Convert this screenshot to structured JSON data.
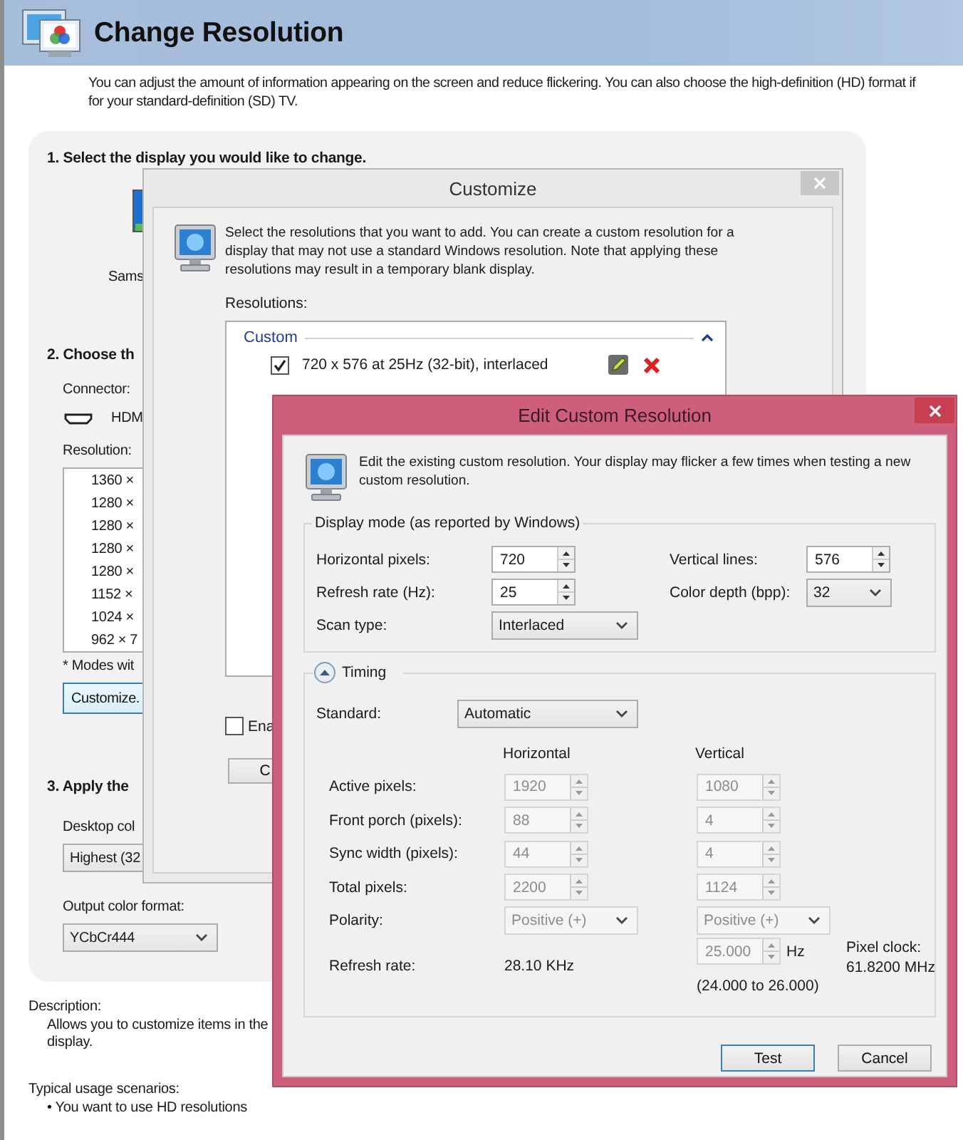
{
  "main_window": {
    "title": "Change Resolution",
    "intro_lines": [
      "You can adjust the amount of information appearing on the screen and reduce flickering. You can also choose the high-definition (HD) format if",
      "for your standard-definition (SD) TV."
    ],
    "step_1": {
      "heading": "1. Select the display you would like to change.",
      "display_name": "Sams"
    },
    "step_2": {
      "heading": "2. Choose th",
      "connector_label": "Connector:",
      "connector": "HDM",
      "resolution_label": "Resolution:",
      "resolutions": [
        {
          "label": "1360 ×",
          "selected": false
        },
        {
          "label": "1280 ×",
          "selected": false
        },
        {
          "label": "1280 ×",
          "selected": false
        },
        {
          "label": "1280 ×",
          "selected": false
        },
        {
          "label": "1280 ×",
          "selected": false
        },
        {
          "label": "1152 ×",
          "selected": false
        },
        {
          "label": "1024 ×",
          "selected": false
        },
        {
          "label": "962 × 7",
          "selected": false
        }
      ],
      "footnote": "* Modes wit",
      "customize_button": "Customize."
    },
    "step_3": {
      "heading": "3. Apply the",
      "desktop_color_label": "Desktop col",
      "desktop_color": "Highest (32",
      "output_format_label": "Output color format:",
      "output_format": "YCbCr444"
    },
    "description_label": "Description:",
    "description_lines": [
      "Allows you to customize items in the",
      "display."
    ],
    "usage_label": "Typical usage scenarios:",
    "usage_items": [
      "• You want to use HD resolutions"
    ]
  },
  "customize_dialog": {
    "title": "Customize",
    "intro": "Select the resolutions that you want to add. You can create a custom resolution for a display that may not use a standard Windows resolution. Note that applying these resolutions may result in a temporary blank display.",
    "resolutions_label": "Resolutions:",
    "groups": [
      {
        "label": "Custom",
        "expanded": true,
        "items": [
          {
            "label": "720 x 576 at 25Hz (32-bit), interlaced",
            "checked": true
          }
        ]
      }
    ],
    "enable_option": {
      "label": "Ena",
      "checked": false
    },
    "button": "C"
  },
  "edit_dialog": {
    "title": "Edit Custom Resolution",
    "intro": "Edit the existing custom resolution. Your display may flicker a few times when testing a new custom resolution.",
    "display_mode": {
      "legend": "Display mode (as reported by Windows)",
      "fields": [
        {
          "kind": "spin",
          "label": "Horizontal pixels:",
          "value": "720"
        },
        {
          "kind": "spin",
          "label": "Vertical lines:",
          "value": "576"
        },
        {
          "kind": "spin",
          "label": "Refresh rate (Hz):",
          "value": "25"
        },
        {
          "kind": "select",
          "label": "Color depth (bpp):",
          "value": "32"
        },
        {
          "kind": "select",
          "label": "Scan type:",
          "value": "Interlaced"
        }
      ]
    },
    "timing": {
      "legend": "Timing",
      "expanded": true,
      "standard_label": "Standard:",
      "standard": "Automatic",
      "columns": [
        "Horizontal",
        "Vertical"
      ],
      "rows": [
        {
          "label": "Active pixels:",
          "cells": [
            {
              "kind": "spin",
              "value": "1920",
              "disabled": true
            },
            {
              "kind": "spin",
              "value": "1080",
              "disabled": true
            }
          ]
        },
        {
          "label": "Front porch (pixels):",
          "cells": [
            {
              "kind": "spin",
              "value": "88",
              "disabled": true
            },
            {
              "kind": "spin",
              "value": "4",
              "disabled": true
            }
          ]
        },
        {
          "label": "Sync width (pixels):",
          "cells": [
            {
              "kind": "spin",
              "value": "44",
              "disabled": true
            },
            {
              "kind": "spin",
              "value": "4",
              "disabled": true
            }
          ]
        },
        {
          "label": "Total pixels:",
          "cells": [
            {
              "kind": "spin",
              "value": "2200",
              "disabled": true
            },
            {
              "kind": "spin",
              "value": "1124",
              "disabled": true
            }
          ]
        },
        {
          "label": "Polarity:",
          "cells": [
            {
              "kind": "select",
              "value": "Positive (+)",
              "disabled": true
            },
            {
              "kind": "select",
              "value": "Positive (+)",
              "disabled": true
            }
          ]
        },
        {
          "label": "Refresh rate:",
          "cells": [
            {
              "kind": "text",
              "value": "28.10 KHz"
            },
            {
              "kind": "spin",
              "value": "25.000",
              "disabled": true,
              "unit": "Hz",
              "note": "(24.000 to 26.000)"
            }
          ]
        }
      ],
      "pixel_clock_label": "Pixel clock:",
      "pixel_clock": "61.8200 MHz"
    },
    "buttons": [
      {
        "label": "Test",
        "focused": true
      },
      {
        "label": "Cancel",
        "focused": false
      }
    ]
  }
}
